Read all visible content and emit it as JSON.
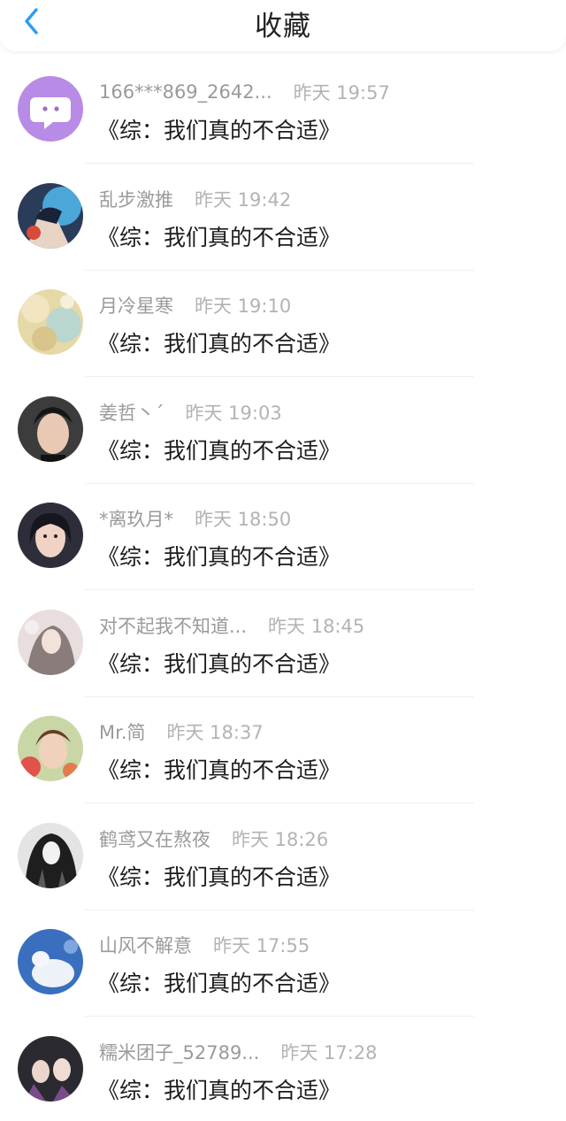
{
  "header": {
    "title": "收藏",
    "back_icon": "chevron-left-icon",
    "accent": "#2a9df4"
  },
  "items": [
    {
      "user": "166***869_2642...",
      "time": "昨天 19:57",
      "book": "《综：我们真的不合适》",
      "avatar": "chat-bubble-icon"
    },
    {
      "user": "乱步激推",
      "time": "昨天 19:42",
      "book": "《综：我们真的不合适》"
    },
    {
      "user": "月冷星寒",
      "time": "昨天 19:10",
      "book": "《综：我们真的不合适》"
    },
    {
      "user": "姜哲丶´",
      "time": "昨天 19:03",
      "book": "《综：我们真的不合适》"
    },
    {
      "user": "*离玖月*",
      "time": "昨天 18:50",
      "book": "《综：我们真的不合适》"
    },
    {
      "user": "对不起我不知道...",
      "time": "昨天 18:45",
      "book": "《综：我们真的不合适》"
    },
    {
      "user": "Mr.简",
      "time": "昨天 18:37",
      "book": "《综：我们真的不合适》"
    },
    {
      "user": "鹤鸢又在熬夜",
      "time": "昨天 18:26",
      "book": "《综：我们真的不合适》"
    },
    {
      "user": "山风不解意",
      "time": "昨天 17:55",
      "book": "《综：我们真的不合适》"
    },
    {
      "user": "糯米团子_52789...",
      "time": "昨天 17:28",
      "book": "《综：我们真的不合适》"
    }
  ]
}
